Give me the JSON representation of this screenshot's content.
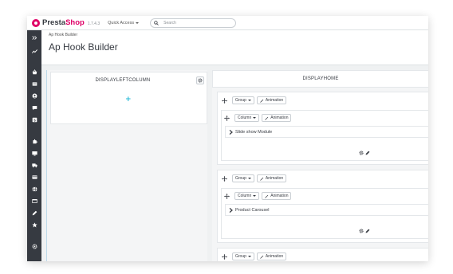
{
  "header": {
    "brand_dark": "Presta",
    "brand_pink": "Shop",
    "version": "1.7.4.3",
    "quick_access": "Quick Access",
    "search_placeholder": "Search"
  },
  "sidebar": {
    "icons": [
      "collapse-icon",
      "stats-icon",
      "orders-icon",
      "catalog-icon",
      "customers-icon",
      "messages-icon",
      "reports-icon",
      "modules-icon",
      "design-icon",
      "shipping-icon",
      "payment-icon",
      "international-icon",
      "shop-icon",
      "edit-icon",
      "star-icon",
      "settings-icon"
    ]
  },
  "page": {
    "breadcrumb": "Ap Hook Builder",
    "title": "Ap Hook Builder"
  },
  "left_column": {
    "title": "DISPLAYLEFTCOLUMN"
  },
  "right_column": {
    "title": "DISPLAYHOME",
    "groups": [
      {
        "group_label": "Group",
        "animation_label": "Animation",
        "column_label": "Column",
        "column_animation_label": "Animation",
        "module": "Slide show Module"
      },
      {
        "group_label": "Group",
        "animation_label": "Animation",
        "column_label": "Column",
        "column_animation_label": "Animation",
        "module": "Product Carousel"
      },
      {
        "group_label": "Group",
        "animation_label": "Animation"
      }
    ]
  },
  "colors": {
    "accent": "#25b9d7",
    "brand": "#df0067",
    "sidebar": "#363a41"
  }
}
